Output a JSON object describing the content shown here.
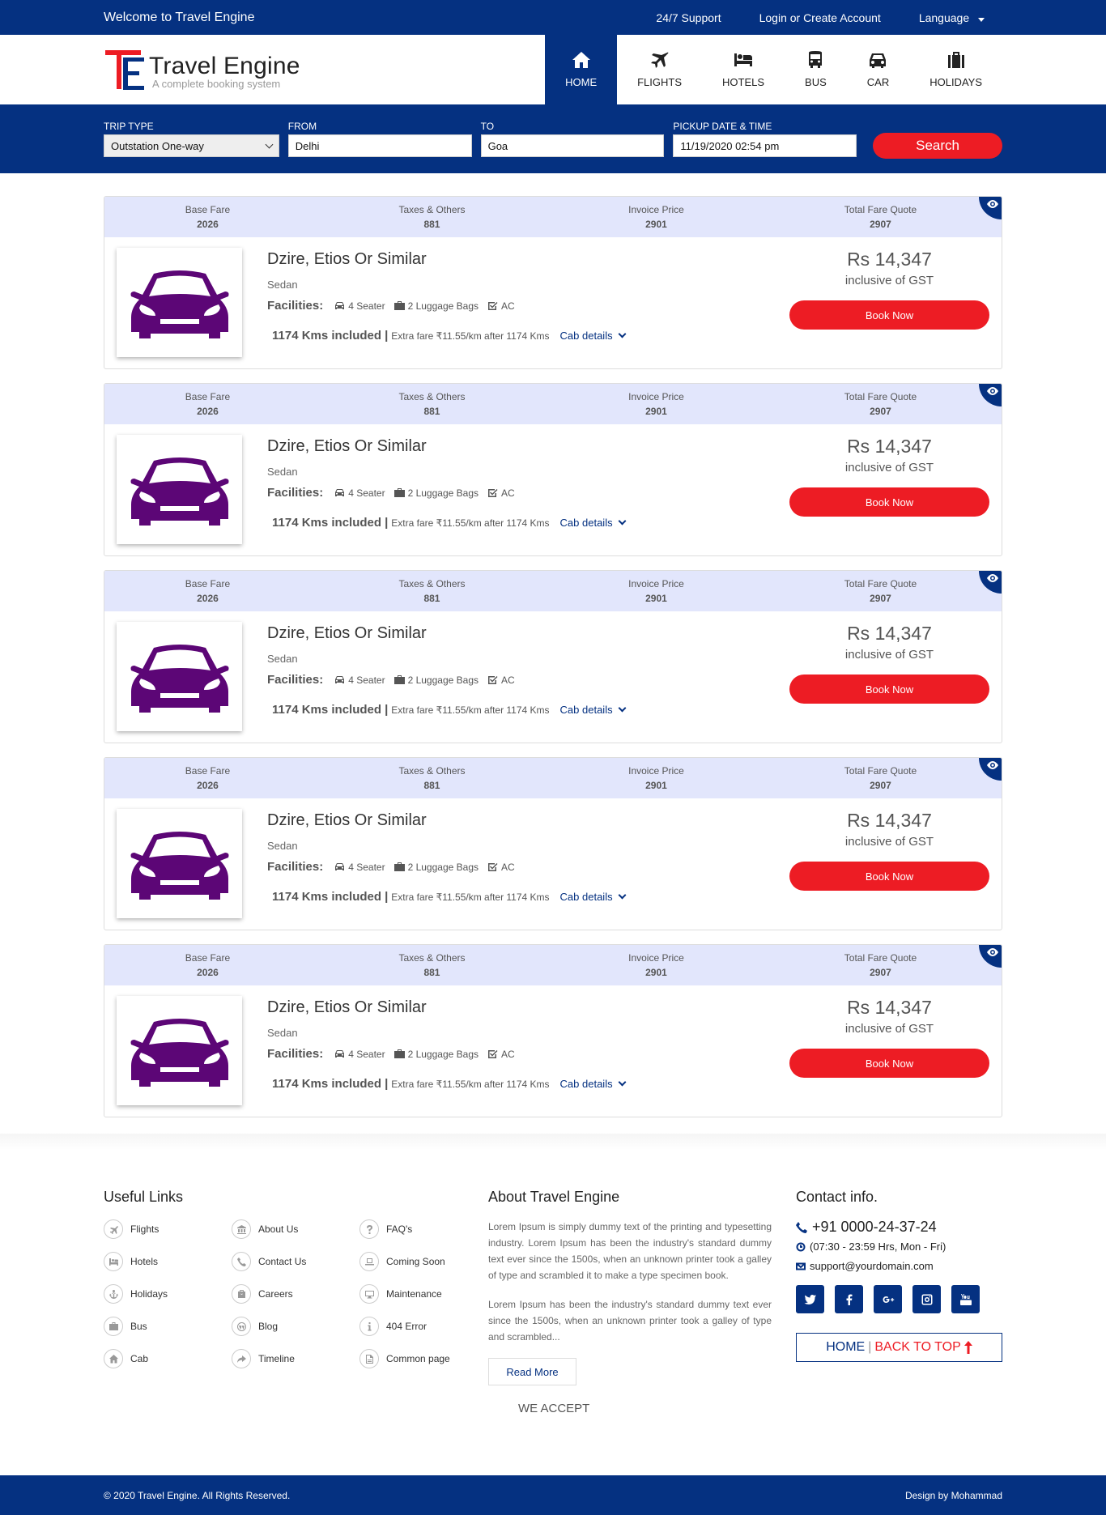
{
  "topbar": {
    "welcome": "Welcome to Travel Engine",
    "support": "24/7 Support",
    "login": "Login or Create Account",
    "language": "Language"
  },
  "brand": {
    "title": "Travel Engine",
    "subtitle": "A complete booking system"
  },
  "nav": [
    {
      "label": "HOME",
      "icon": "home-icon",
      "active": true
    },
    {
      "label": "FLIGHTS",
      "icon": "plane-icon"
    },
    {
      "label": "HOTELS",
      "icon": "bed-icon"
    },
    {
      "label": "BUS",
      "icon": "bus-icon"
    },
    {
      "label": "CAR",
      "icon": "car-icon"
    },
    {
      "label": "HOLIDAYS",
      "icon": "suitcase-icon"
    }
  ],
  "search": {
    "trip_type_label": "TRIP TYPE",
    "trip_type_value": "Outstation One-way",
    "from_label": "FROM",
    "from_value": "Delhi",
    "to_label": "TO",
    "to_value": "Goa",
    "pickup_label": "PICKUP DATE & TIME",
    "pickup_value": "11/19/2020 02:54 pm",
    "button": "Search"
  },
  "fare_labels": {
    "base": "Base Fare",
    "taxes": "Taxes & Others",
    "invoice": "Invoice Price",
    "total": "Total Fare Quote"
  },
  "results": [
    {
      "base": "2026",
      "taxes": "881",
      "invoice": "2901",
      "total": "2907",
      "name": "Dzire, Etios Or Similar",
      "type": "Sedan",
      "facilities_label": "Facilities:",
      "seater": "4 Seater",
      "luggage": "2 Luggage Bags",
      "ac": "AC",
      "kms": "1174 Kms included",
      "sep": "|",
      "extra": "Extra fare ₹11.55/km after 1174 Kms",
      "cab": "Cab details",
      "price": "Rs 14,347",
      "gst": "inclusive of GST",
      "book": "Book Now"
    },
    {
      "base": "2026",
      "taxes": "881",
      "invoice": "2901",
      "total": "2907",
      "name": "Dzire, Etios Or Similar",
      "type": "Sedan",
      "facilities_label": "Facilities:",
      "seater": "4 Seater",
      "luggage": "2 Luggage Bags",
      "ac": "AC",
      "kms": "1174 Kms included",
      "sep": "|",
      "extra": "Extra fare ₹11.55/km after 1174 Kms",
      "cab": "Cab details",
      "price": "Rs 14,347",
      "gst": "inclusive of GST",
      "book": "Book Now"
    },
    {
      "base": "2026",
      "taxes": "881",
      "invoice": "2901",
      "total": "2907",
      "name": "Dzire, Etios Or Similar",
      "type": "Sedan",
      "facilities_label": "Facilities:",
      "seater": "4 Seater",
      "luggage": "2 Luggage Bags",
      "ac": "AC",
      "kms": "1174 Kms included",
      "sep": "|",
      "extra": "Extra fare ₹11.55/km after 1174 Kms",
      "cab": "Cab details",
      "price": "Rs 14,347",
      "gst": "inclusive of GST",
      "book": "Book Now"
    },
    {
      "base": "2026",
      "taxes": "881",
      "invoice": "2901",
      "total": "2907",
      "name": "Dzire, Etios Or Similar",
      "type": "Sedan",
      "facilities_label": "Facilities:",
      "seater": "4 Seater",
      "luggage": "2 Luggage Bags",
      "ac": "AC",
      "kms": "1174 Kms included",
      "sep": "|",
      "extra": "Extra fare ₹11.55/km after 1174 Kms",
      "cab": "Cab details",
      "price": "Rs 14,347",
      "gst": "inclusive of GST",
      "book": "Book Now"
    },
    {
      "base": "2026",
      "taxes": "881",
      "invoice": "2901",
      "total": "2907",
      "name": "Dzire, Etios Or Similar",
      "type": "Sedan",
      "facilities_label": "Facilities:",
      "seater": "4 Seater",
      "luggage": "2 Luggage Bags",
      "ac": "AC",
      "kms": "1174 Kms included",
      "sep": "|",
      "extra": "Extra fare ₹11.55/km after 1174 Kms",
      "cab": "Cab details",
      "price": "Rs 14,347",
      "gst": "inclusive of GST",
      "book": "Book Now"
    }
  ],
  "footer": {
    "links_title": "Useful Links",
    "links": [
      {
        "label": "Flights",
        "icon": "plane-icon"
      },
      {
        "label": "About Us",
        "icon": "bank-icon"
      },
      {
        "label": "FAQ's",
        "icon": "question-icon"
      },
      {
        "label": "Hotels",
        "icon": "bed-icon"
      },
      {
        "label": "Contact Us",
        "icon": "phone-icon"
      },
      {
        "label": "Coming Soon",
        "icon": "laptop-icon"
      },
      {
        "label": "Holidays",
        "icon": "anchor-icon"
      },
      {
        "label": "Careers",
        "icon": "briefcase-icon"
      },
      {
        "label": "Maintenance",
        "icon": "desktop-icon"
      },
      {
        "label": "Bus",
        "icon": "suitcase-icon"
      },
      {
        "label": "Blog",
        "icon": "wordpress-icon"
      },
      {
        "label": "404 Error",
        "icon": "info-icon"
      },
      {
        "label": "Cab",
        "icon": "home-icon"
      },
      {
        "label": "Timeline",
        "icon": "share-icon"
      },
      {
        "label": "Common page",
        "icon": "file-icon"
      }
    ],
    "about_title": "About Travel Engine",
    "about_p1": "Lorem Ipsum is simply dummy text of the printing and typesetting industry. Lorem Ipsum has been the industry's standard dummy text ever since the 1500s, when an unknown printer took a galley of type and scrambled it to make a type specimen book.",
    "about_p2": "Lorem Ipsum has been the industry's standard dummy text ever since the 1500s, when an unknown printer took a galley of type and scrambled...",
    "read_more": "Read More",
    "we_accept": "WE ACCEPT",
    "contact_title": "Contact info.",
    "phone": "+91 0000-24-37-24",
    "hours": "(07:30 - 23:59 Hrs, Mon - Fri)",
    "email": "support@yourdomain.com",
    "home": "HOME",
    "sep": "|",
    "back_to_top": "BACK TO TOP",
    "copyright": "© 2020 Travel Engine. All Rights Reserved.",
    "design_by": "Design by Mohammad"
  },
  "colors": {
    "primary": "#053181",
    "accent": "#ed1c24",
    "fare_bg": "#e2e6fc",
    "car": "#5c0676"
  }
}
